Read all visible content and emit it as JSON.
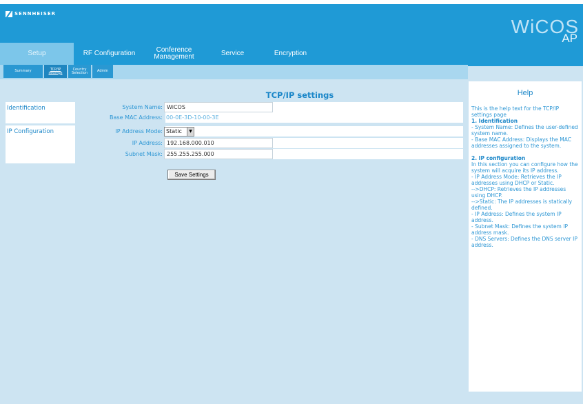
{
  "header": {
    "logo_text": "SENNHEISER",
    "brand_name": "WiCOS",
    "brand_sub": "AP"
  },
  "main_tabs": [
    {
      "label": "Setup",
      "active": true
    },
    {
      "label": "RF Configuration",
      "active": false
    },
    {
      "label": "Conference Management",
      "active": false
    },
    {
      "label": "Service",
      "active": false
    },
    {
      "label": "Encryption",
      "active": false
    }
  ],
  "sub_tabs": [
    {
      "label": "Summary",
      "active": false
    },
    {
      "label": "TCP/IP settings",
      "active": true
    },
    {
      "label": "Country Selection",
      "active": false
    },
    {
      "label": "Admin",
      "active": false
    }
  ],
  "page_title": "TCP/IP settings",
  "sections": {
    "identification": "Identification",
    "ip_configuration": "IP Configuration"
  },
  "form": {
    "system_name_label": "System Name:",
    "system_name_value": "WiCOS",
    "mac_label": "Base MAC Address:",
    "mac_value": "00-0E-3D-10-00-3E",
    "ip_mode_label": "IP Address Mode:",
    "ip_mode_value": "Static",
    "ip_address_label": "IP Address:",
    "ip_address_value": "192.168.000.010",
    "subnet_label": "Subnet Mask:",
    "subnet_value": "255.255.255.000",
    "save_label": "Save Settings"
  },
  "help": {
    "title": "Help",
    "intro": "This is the help text for the TCP/IP settings page",
    "h1": "1. Identification",
    "id_lines": [
      "- System Name: Defines the user-defined system name.",
      "- Base MAC Address: Displays the MAC addresses assigned to the system."
    ],
    "h2": "2. IP configuration",
    "ip_lines": [
      "In this section you can configure how the system will acquire its IP address.",
      "- IP Address Mode: Retrieves the IP addresses using DHCP or Static.",
      "-->DHCP: Retrieves the IP addresses using DHCP.",
      "-->Static: The IP addresses is statically defined.",
      "- IP Address: Defines the system IP address.",
      "- Subnet Mask: Defines the system IP address mask.",
      "- DNS Servers: Defines the DNS server IP address."
    ]
  },
  "colors": {
    "header_blue": "#1f9ad6",
    "active_tab": "#7cc6ea",
    "content_bg": "#cde4f2",
    "text_blue": "#2c96d4"
  }
}
